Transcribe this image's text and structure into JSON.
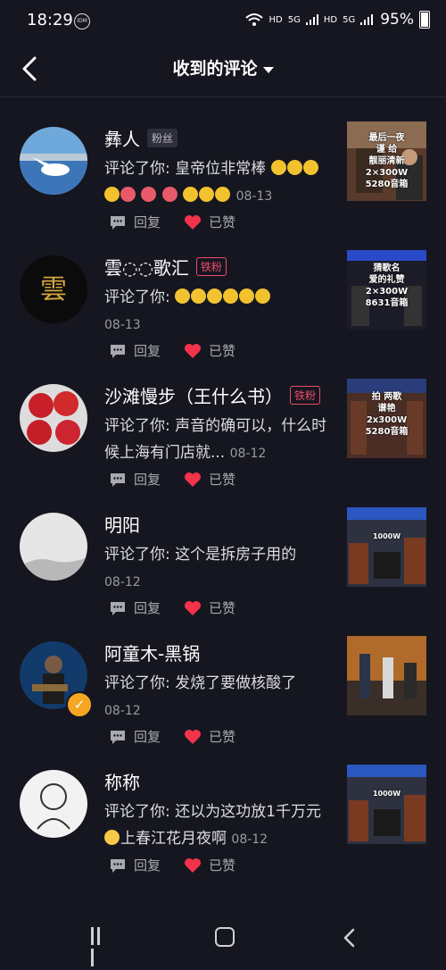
{
  "status": {
    "time": "18:29",
    "idm": "IDM",
    "hd1": "HD",
    "g1": "5G",
    "hd2": "HD",
    "g2": "5G",
    "battery": "95%"
  },
  "header": {
    "title": "收到的评论"
  },
  "actions": {
    "reply_label": "回复",
    "like_label": "已赞"
  },
  "comments": [
    {
      "name": "彝人",
      "badge": "粉丝",
      "badge_type": "fan",
      "prefix": "评论了你: ",
      "text": "皇帝位非常棒",
      "date": "08-13",
      "thumb_text": [
        "最后一夜",
        "谨 给",
        "靓丽清新",
        "2×300W",
        "5280音箱"
      ]
    },
    {
      "name": "雲◌◌歌汇",
      "badge": "铁粉",
      "badge_type": "iron",
      "prefix": "评论了你: ",
      "text": "",
      "date": "08-13",
      "thumb_text": [
        "猜歌名",
        "爱的礼赞",
        "2×300W",
        "8631音箱"
      ]
    },
    {
      "name": "沙滩慢步（王什么书）",
      "badge": "铁粉",
      "badge_type": "iron",
      "prefix": "评论了你: ",
      "text": "声音的确可以，什么时候上海有门店就...",
      "date": "08-12",
      "thumb_text": [
        "拍 两歌",
        "谱艳",
        "2x300W",
        "5280音箱"
      ]
    },
    {
      "name": "明阳",
      "badge": "",
      "badge_type": "none",
      "prefix": "评论了你: ",
      "text": "这个是拆房子用的",
      "date": "08-12",
      "thumb_text": [
        "",
        "1000W",
        "",
        ""
      ]
    },
    {
      "name": "阿童木-黑锅",
      "badge": "",
      "badge_type": "none",
      "prefix": "评论了你: ",
      "text": "发烧了要做核酸了",
      "date": "08-12",
      "thumb_text": []
    },
    {
      "name": "称称",
      "badge": "",
      "badge_type": "none",
      "prefix": "评论了你: ",
      "text": "还以为这功放1千万元",
      "text2": "上春江花月夜啊",
      "date": "08-12",
      "thumb_text": [
        "",
        "1000W",
        "",
        ""
      ]
    }
  ]
}
